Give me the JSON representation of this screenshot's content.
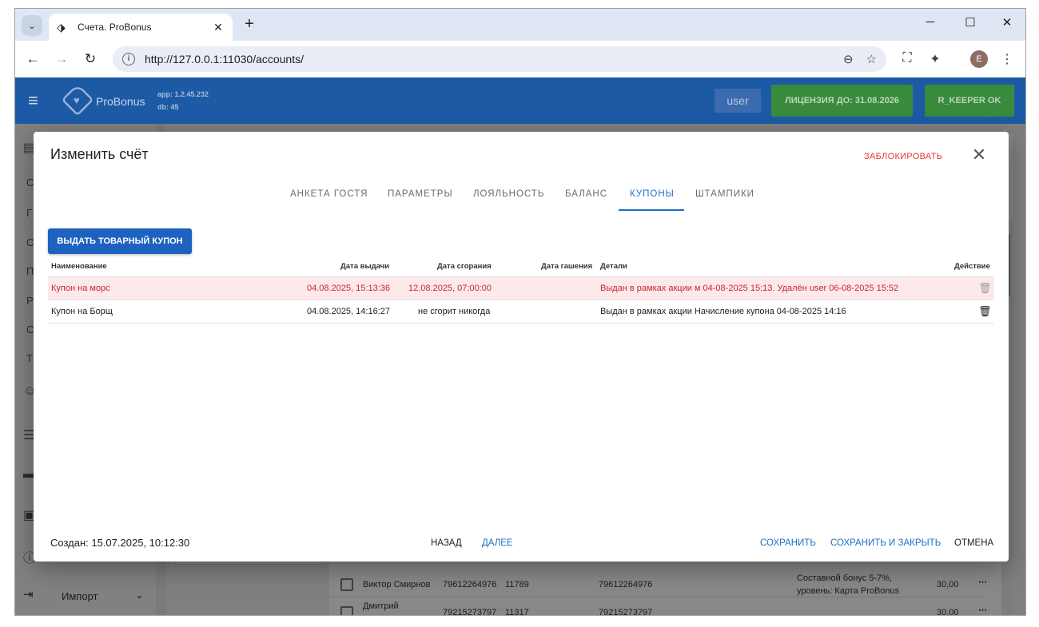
{
  "browser": {
    "tab_title": "Счета. ProBonus",
    "url": "http://127.0.0.1:11030/accounts/",
    "profile_initial": "E"
  },
  "appbar": {
    "brand": "ProBonus",
    "app_version": "app: 1.2.45.232",
    "db_version": "db: 45",
    "user": "user",
    "license": "ЛИЦЕНЗИЯ ДО: 31.08.2026",
    "rkeeper": "R_KEEPER OK",
    "accent_color": "#1c5aa6",
    "ok_color": "#3a8a3e"
  },
  "sidebar": {
    "letters": [
      "С",
      "Г",
      "С",
      "П",
      "Р",
      "С",
      "Т"
    ],
    "import_label": "Импорт"
  },
  "background_rows": [
    {
      "name": "Виктор Смирнов",
      "phone": "79612264976",
      "code": "11789",
      "card": "79612264976",
      "bonus_line1": "Составной бонус 5-7%,",
      "bonus_line2": "уровень: Карта ProBonus",
      "amount": "30,00"
    },
    {
      "name": "Дмитрий",
      "phone": "79215273797",
      "code": "11317",
      "card": "79215273797",
      "bonus_line1": "",
      "bonus_line2": "",
      "amount": "30,00"
    }
  ],
  "modal": {
    "title": "Изменить счёт",
    "block_label": "ЗАБЛОКИРОВАТЬ",
    "tabs": [
      {
        "label": "АНКЕТА ГОСТЯ",
        "active": false
      },
      {
        "label": "ПАРАМЕТРЫ",
        "active": false
      },
      {
        "label": "ЛОЯЛЬНОСТЬ",
        "active": false
      },
      {
        "label": "БАЛАНС",
        "active": false
      },
      {
        "label": "КУПОНЫ",
        "active": true
      },
      {
        "label": "ШТАМПИКИ",
        "active": false
      }
    ],
    "issue_button": "ВЫДАТЬ ТОВАРНЫЙ КУПОН",
    "columns": {
      "name": "Наименование",
      "issued": "Дата выдачи",
      "expires": "Дата сгорания",
      "redeemed": "Дата гашения",
      "details": "Детали",
      "action": "Действие"
    },
    "rows": [
      {
        "name": "Купон на морс",
        "issued": "04.08.2025, 15:13:36",
        "expires": "12.08.2025, 07:00:00",
        "redeemed": "",
        "details": "Выдан в рамках акции м 04-08-2025 15:13. Удалён user 06-08-2025 15:52",
        "deleted": true,
        "action_icon": "delete-off-icon"
      },
      {
        "name": "Купон на Борщ",
        "issued": "04.08.2025, 14:16:27",
        "expires": "не сгорит никогда",
        "redeemed": "",
        "details": "Выдан в рамках акции Начисление купона 04-08-2025 14:16",
        "deleted": false,
        "action_icon": "trash-icon"
      }
    ],
    "created": "Создан: 15.07.2025, 10:12:30",
    "back": "НАЗАД",
    "next": "ДАЛЕЕ",
    "save": "СОХРАНИТЬ",
    "save_close": "СОХРАНИТЬ И ЗАКРЫТЬ",
    "cancel": "ОТМЕНА"
  }
}
